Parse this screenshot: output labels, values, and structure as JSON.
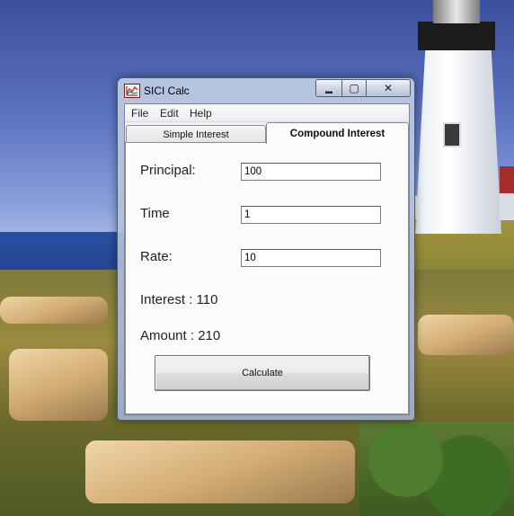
{
  "window": {
    "title": "SICI Calc",
    "controls": {
      "minimize": "▬",
      "maximize": "▢",
      "close": "✕"
    }
  },
  "menu": {
    "items": [
      "File",
      "Edit",
      "Help"
    ]
  },
  "tabs": [
    {
      "label": "Simple Interest",
      "active": false
    },
    {
      "label": "Compound Interest",
      "active": true
    }
  ],
  "form": {
    "principal": {
      "label": "Principal:",
      "value": "100"
    },
    "time": {
      "label": "Time",
      "value": "1"
    },
    "rate": {
      "label": "Rate:",
      "value": "10"
    }
  },
  "results": {
    "interest": "Interest : 110",
    "amount": "Amount : 210"
  },
  "actions": {
    "calculate": "Calculate"
  },
  "icons": {
    "app": "chart-icon"
  }
}
